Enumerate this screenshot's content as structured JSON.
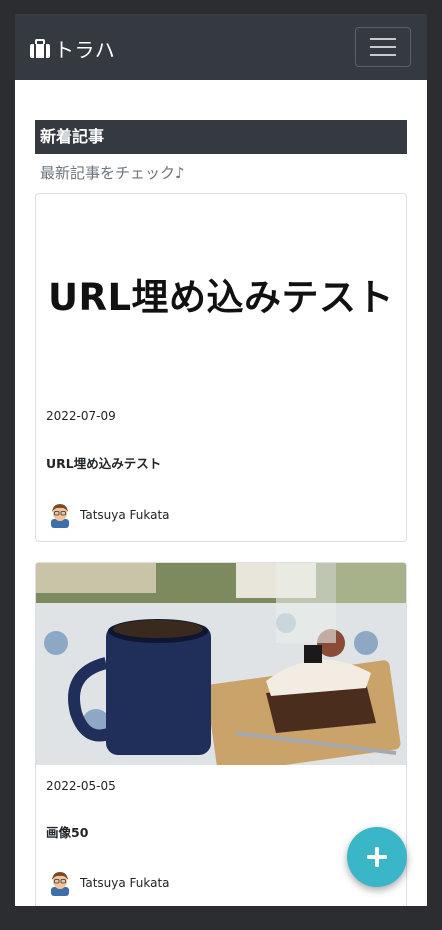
{
  "navbar": {
    "brand_icon": "briefcase-icon",
    "brand_text": "トラハ",
    "toggler_icon": "hamburger-menu-icon"
  },
  "section": {
    "title": "新着記事",
    "subtitle": "最新記事をチェック♪"
  },
  "articles": [
    {
      "thumbnail_text": "URL埋め込みテスト",
      "date": "2022-07-09",
      "title": "URL埋め込みテスト",
      "author": "Tatsuya Fukata"
    },
    {
      "thumbnail": "coffee-and-cake-photo",
      "date": "2022-05-05",
      "title": "画像50",
      "author": "Tatsuya Fukata"
    }
  ],
  "fab": {
    "icon": "plus-icon",
    "color": "#3ab6c9"
  },
  "colors": {
    "navbar": "#343a40",
    "background": "#2b2d31"
  }
}
